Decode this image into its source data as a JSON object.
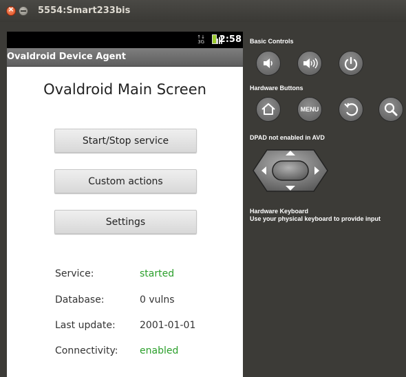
{
  "window": {
    "title": "5554:Smart233bis"
  },
  "status_bar": {
    "time": "2:58",
    "network": "3G"
  },
  "app": {
    "title": "Ovaldroid Device Agent",
    "heading": "Ovaldroid Main Screen",
    "buttons": {
      "start_stop": "Start/Stop service",
      "custom_actions": "Custom actions",
      "settings": "Settings"
    },
    "info": [
      {
        "label": "Service:",
        "value": "started"
      },
      {
        "label": "Database:",
        "value": "0 vulns"
      },
      {
        "label": "Last update:",
        "value": "2001-01-01"
      },
      {
        "label": "Connectivity:",
        "value": "enabled"
      }
    ]
  },
  "controls": {
    "basic_label": "Basic Controls",
    "hardware_label": "Hardware Buttons",
    "menu_label": "MENU",
    "dpad_label": "DPAD not enabled in AVD",
    "keyboard_label": "Hardware Keyboard",
    "keyboard_hint": "Use your physical keyboard to provide input"
  },
  "icons": [
    "close-icon",
    "minimize-icon",
    "volume-down-icon",
    "volume-up-icon",
    "power-icon",
    "home-icon",
    "back-icon",
    "search-icon",
    "dpad-icon"
  ],
  "colors": {
    "accent_green": "#2a9f2a",
    "panel_bg": "#3c3b37"
  }
}
